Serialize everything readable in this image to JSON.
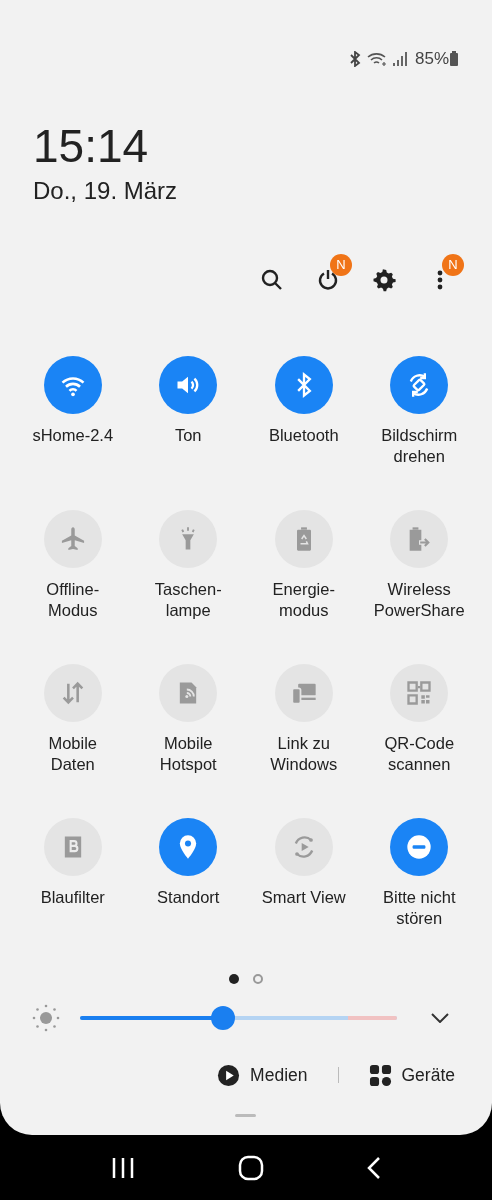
{
  "status_bar": {
    "battery": "85%"
  },
  "clock": {
    "time": "15:14",
    "date": "Do., 19. März"
  },
  "actions": [
    {
      "kind": "search"
    },
    {
      "kind": "power",
      "badge": "N"
    },
    {
      "kind": "settings"
    },
    {
      "kind": "menu",
      "badge": "N"
    }
  ],
  "tiles": [
    {
      "label": "sHome-2.4",
      "on": true
    },
    {
      "label": "Ton",
      "on": true
    },
    {
      "label": "Bluetooth",
      "on": true
    },
    {
      "label": "Bildschirm drehen",
      "on": true
    },
    {
      "label": "Offline-Modus",
      "on": false
    },
    {
      "label": "Taschen-lampe",
      "on": false
    },
    {
      "label": "Energie-modus",
      "on": false
    },
    {
      "label": "Wireless PowerShare",
      "on": false
    },
    {
      "label": "Mobile Daten",
      "on": false
    },
    {
      "label": "Mobile Hotspot",
      "on": false
    },
    {
      "label": "Link zu Windows",
      "on": false
    },
    {
      "label": "QR-Code scannen",
      "on": false
    },
    {
      "label": "Blaufilter",
      "on": false
    },
    {
      "label": "Standort",
      "on": true
    },
    {
      "label": "Smart View",
      "on": false
    },
    {
      "label": "Bitte nicht stören",
      "on": true
    }
  ],
  "pages": [
    {
      "selected": true
    },
    {
      "selected": false
    }
  ],
  "brightness": {
    "level": 0.45
  },
  "buttons": [
    {
      "label": "Medien"
    },
    {
      "label": "Geräte"
    }
  ]
}
